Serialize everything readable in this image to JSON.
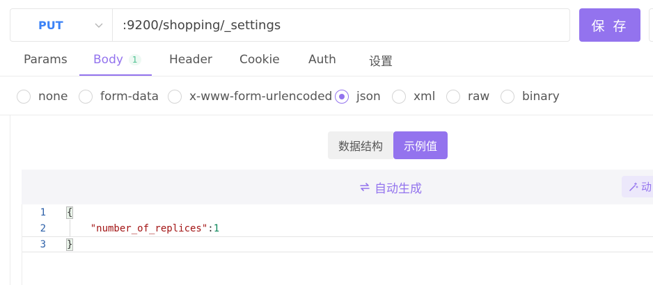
{
  "request": {
    "method": "PUT",
    "url": ":9200/shopping/_settings",
    "save_label": "保 存"
  },
  "tabs": [
    {
      "label": "Params"
    },
    {
      "label": "Body",
      "badge": "1"
    },
    {
      "label": "Header"
    },
    {
      "label": "Cookie"
    },
    {
      "label": "Auth"
    },
    {
      "label": "设置"
    }
  ],
  "active_tab": "Body",
  "body_types": [
    {
      "label": "none"
    },
    {
      "label": "form-data"
    },
    {
      "label": "x-www-form-urlencoded"
    },
    {
      "label": "json"
    },
    {
      "label": "xml"
    },
    {
      "label": "raw"
    },
    {
      "label": "binary"
    }
  ],
  "selected_body_type": "json",
  "view_toggle": {
    "schema_label": "数据结构",
    "example_label": "示例值",
    "active": "示例值"
  },
  "editor_toolbar": {
    "autogen_label": "自动生成",
    "dynamic_label": "动"
  },
  "code_lines": [
    {
      "num": "1",
      "text": "{"
    },
    {
      "num": "2",
      "key": "\"number_of_replices\"",
      "sep": ":",
      "value": "1"
    },
    {
      "num": "3",
      "text": "}"
    }
  ],
  "colors": {
    "accent": "#9373ee",
    "method": "#3b82f6",
    "badge": "#4bbf8f"
  }
}
